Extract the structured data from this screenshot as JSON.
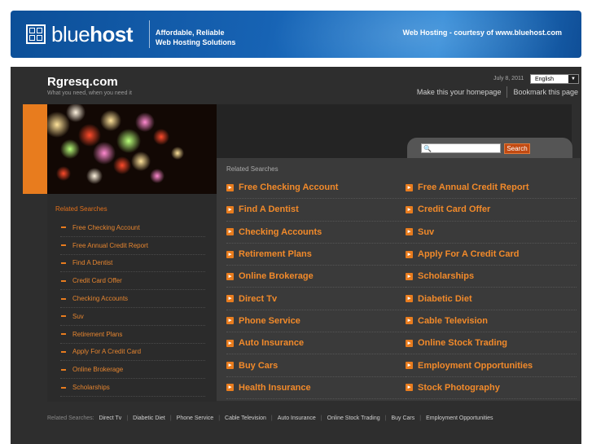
{
  "banner": {
    "logo_light": "blue",
    "logo_bold": "host",
    "tagline_line1": "Affordable, Reliable",
    "tagline_line2": "Web Hosting Solutions",
    "courtesy": "Web Hosting - courtesy of www.bluehost.com"
  },
  "header": {
    "title": "Rgresq.com",
    "tagline": "What you need, when you need it",
    "date": "July 8, 2011",
    "language": "English",
    "homepage_link": "Make this your homepage",
    "bookmark_link": "Bookmark this page"
  },
  "search": {
    "button_label": "Search",
    "placeholder": ""
  },
  "sidebar": {
    "heading": "Related Searches",
    "items": [
      "Free Checking Account",
      "Free Annual Credit Report",
      "Find A Dentist",
      "Credit Card Offer",
      "Checking Accounts",
      "Suv",
      "Retirement Plans",
      "Apply For A Credit Card",
      "Online Brokerage",
      "Scholarships"
    ]
  },
  "main": {
    "heading": "Related Searches",
    "items": [
      "Free Checking Account",
      "Free Annual Credit Report",
      "Find A Dentist",
      "Credit Card Offer",
      "Checking Accounts",
      "Suv",
      "Retirement Plans",
      "Apply For A Credit Card",
      "Online Brokerage",
      "Scholarships",
      "Direct Tv",
      "Diabetic Diet",
      "Phone Service",
      "Cable Television",
      "Auto Insurance",
      "Online Stock Trading",
      "Buy Cars",
      "Employment Opportunities",
      "Health Insurance",
      "Stock Photography"
    ]
  },
  "footer": {
    "label": "Related Searches:",
    "items": [
      "Direct Tv",
      "Diabetic Diet",
      "Phone Service",
      "Cable Television",
      "Auto Insurance",
      "Online Stock Trading",
      "Buy Cars",
      "Employment Opportunities"
    ]
  },
  "colors": {
    "accent_orange": "#e87c1e",
    "banner_blue": "#1763b4",
    "page_bg": "#2e2e2e"
  }
}
